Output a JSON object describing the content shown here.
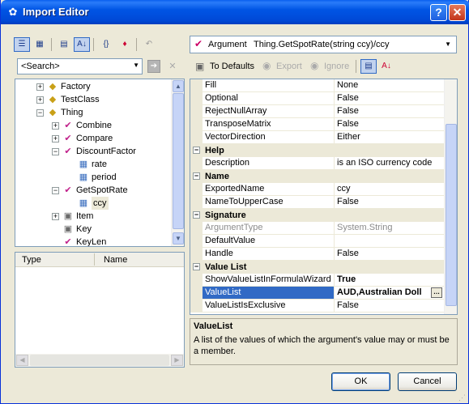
{
  "window": {
    "title": "Import Editor",
    "icon": "butterfly-icon"
  },
  "left_toolbar": {
    "icons": [
      "tree-view-icon",
      "grid-view-icon",
      "categorized-icon",
      "sort-az-icon",
      "braces-icon",
      "clear-icon",
      "undo-icon"
    ]
  },
  "search": {
    "value": "<Search>"
  },
  "tree": {
    "items": [
      {
        "label": "Factory",
        "expander": "+",
        "icon": "class-icon"
      },
      {
        "label": "TestClass",
        "expander": "+",
        "icon": "class-icon"
      },
      {
        "label": "Thing",
        "expander": "−",
        "icon": "class-icon"
      },
      {
        "label": "Combine",
        "expander": "+",
        "icon": "method-icon"
      },
      {
        "label": "Compare",
        "expander": "+",
        "icon": "method-icon"
      },
      {
        "label": "DiscountFactor",
        "expander": "−",
        "icon": "method-icon"
      },
      {
        "label": "rate",
        "expander": "",
        "icon": "argument-icon"
      },
      {
        "label": "period",
        "expander": "",
        "icon": "argument-icon"
      },
      {
        "label": "GetSpotRate",
        "expander": "−",
        "icon": "method-icon"
      },
      {
        "label": "ccy",
        "expander": "",
        "icon": "argument-icon"
      },
      {
        "label": "Item",
        "expander": "+",
        "icon": "property-icon"
      },
      {
        "label": "Key",
        "expander": "",
        "icon": "property-icon"
      },
      {
        "label": "KeyLen",
        "expander": "",
        "icon": "method-icon"
      }
    ]
  },
  "list_panel": {
    "col_type": "Type",
    "col_name": "Name"
  },
  "argument_header": {
    "kind": "Argument",
    "signature": "Thing.GetSpotRate(string ccy)/ccy"
  },
  "right_toolbar": {
    "to_defaults": "To Defaults",
    "export": "Export",
    "ignore": "Ignore"
  },
  "properties": {
    "rows_top": [
      {
        "name": "Fill",
        "value": "None"
      },
      {
        "name": "Optional",
        "value": "False"
      },
      {
        "name": "RejectNullArray",
        "value": "False"
      },
      {
        "name": "TransposeMatrix",
        "value": "False"
      },
      {
        "name": "VectorDirection",
        "value": "Either"
      }
    ],
    "cat_help": "Help",
    "help_rows": [
      {
        "name": "Description",
        "value": "is an ISO currency code"
      }
    ],
    "cat_name": "Name",
    "name_rows": [
      {
        "name": "ExportedName",
        "value": "ccy"
      },
      {
        "name": "NameToUpperCase",
        "value": "False"
      }
    ],
    "cat_signature": "Signature",
    "sig_rows": [
      {
        "name": "ArgumentType",
        "value": "System.String"
      },
      {
        "name": "DefaultValue",
        "value": ""
      },
      {
        "name": "Handle",
        "value": "False"
      }
    ],
    "cat_valuelist": "Value List",
    "vl_rows": [
      {
        "name": "ShowValueListInFormulaWizard",
        "value": "True"
      },
      {
        "name": "ValueList",
        "value": "AUD,Australian Doll"
      },
      {
        "name": "ValueListIsExclusive",
        "value": "False"
      }
    ]
  },
  "description_panel": {
    "title": "ValueList",
    "text": "A list of the values of which the argument's value may or must be a member."
  },
  "buttons": {
    "ok": "OK",
    "cancel": "Cancel"
  },
  "colors": {
    "title_bar": "#0054e3",
    "selection": "#316ac5",
    "face": "#ece9d8"
  }
}
